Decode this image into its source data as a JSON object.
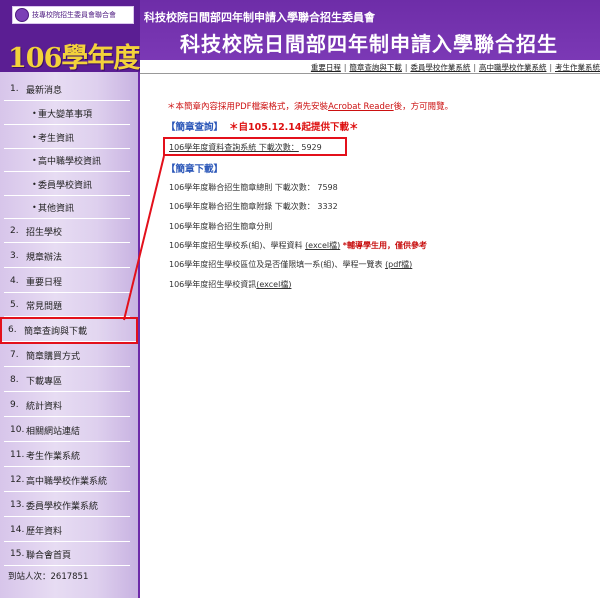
{
  "header": {
    "logo_text": "技專校院招生委員會聯合會",
    "year_title": "106學年度",
    "committee": "科技校院日間部四年制申請入學聯合招生委員會",
    "main_title": "科技校院日間部四年制申請入學聯合招生"
  },
  "topnav": [
    "重要日程",
    "簡章查詢與下載",
    "委員學校作業系統",
    "高中職學校作業系統",
    "考生作業系統"
  ],
  "sidebar": {
    "items": [
      {
        "num": "1.",
        "label": "最新消息"
      },
      {
        "num": "•",
        "label": "重大變革事項"
      },
      {
        "num": "•",
        "label": "考生資訊"
      },
      {
        "num": "•",
        "label": "高中職學校資訊"
      },
      {
        "num": "•",
        "label": "委員學校資訊"
      },
      {
        "num": "•",
        "label": "其他資訊"
      },
      {
        "num": "2.",
        "label": "招生學校"
      },
      {
        "num": "3.",
        "label": "規章辦法"
      },
      {
        "num": "4.",
        "label": "重要日程"
      },
      {
        "num": "5.",
        "label": "常見問題"
      },
      {
        "num": "6.",
        "label": "簡章查詢與下載"
      },
      {
        "num": "7.",
        "label": "簡章購買方式"
      },
      {
        "num": "8.",
        "label": "下載專區"
      },
      {
        "num": "9.",
        "label": "統計資料"
      },
      {
        "num": "10.",
        "label": "相關網站連結"
      },
      {
        "num": "11.",
        "label": "考生作業系統"
      },
      {
        "num": "12.",
        "label": "高中職學校作業系統"
      },
      {
        "num": "13.",
        "label": "委員學校作業系統"
      },
      {
        "num": "14.",
        "label": "歷年資料"
      },
      {
        "num": "15.",
        "label": "聯合會首頁"
      }
    ],
    "visitor_label": "到站人次：",
    "visitor_count": "2617851"
  },
  "content": {
    "notice_pre": "＊本簡章內容採用PDF檔案格式，須先安裝",
    "notice_link": "Acrobat Reader",
    "notice_post": "後，方可閱覽。",
    "query_title": "【簡章查詢】",
    "query_note": "＊自105.12.14起提供下載＊",
    "query_line_label": "106學年度資料查詢系統 下載次數：",
    "query_line_count": "5929",
    "download_title": "【簡章下載】",
    "downloads": [
      {
        "text": "106學年度聯合招生簡章總則 下載次數：",
        "count": "7598"
      },
      {
        "text": "106學年度聯合招生簡章附錄 下載次數：",
        "count": "3332"
      },
      {
        "text": "106學年度聯合招生簡章分則",
        "count": ""
      }
    ],
    "excel_line_pre": "106學年度招生學校系(組)、學程資料",
    "excel_line_link": "(excel檔)",
    "excel_line_note": "*輔導學生用，僅供參考",
    "region_line_pre": "106學年度招生學校區位及是否僅限填一系(組)、學程一覽表",
    "region_line_link": "(pdf檔)",
    "school_line_pre": "106學年度招生學校資訊",
    "school_line_link": "(excel檔)"
  },
  "colors": {
    "header_purple": "#6d2aa8",
    "year_gold": "#f3d23b",
    "highlight_red": "#e3101b",
    "section_blue": "#2a56b8"
  }
}
